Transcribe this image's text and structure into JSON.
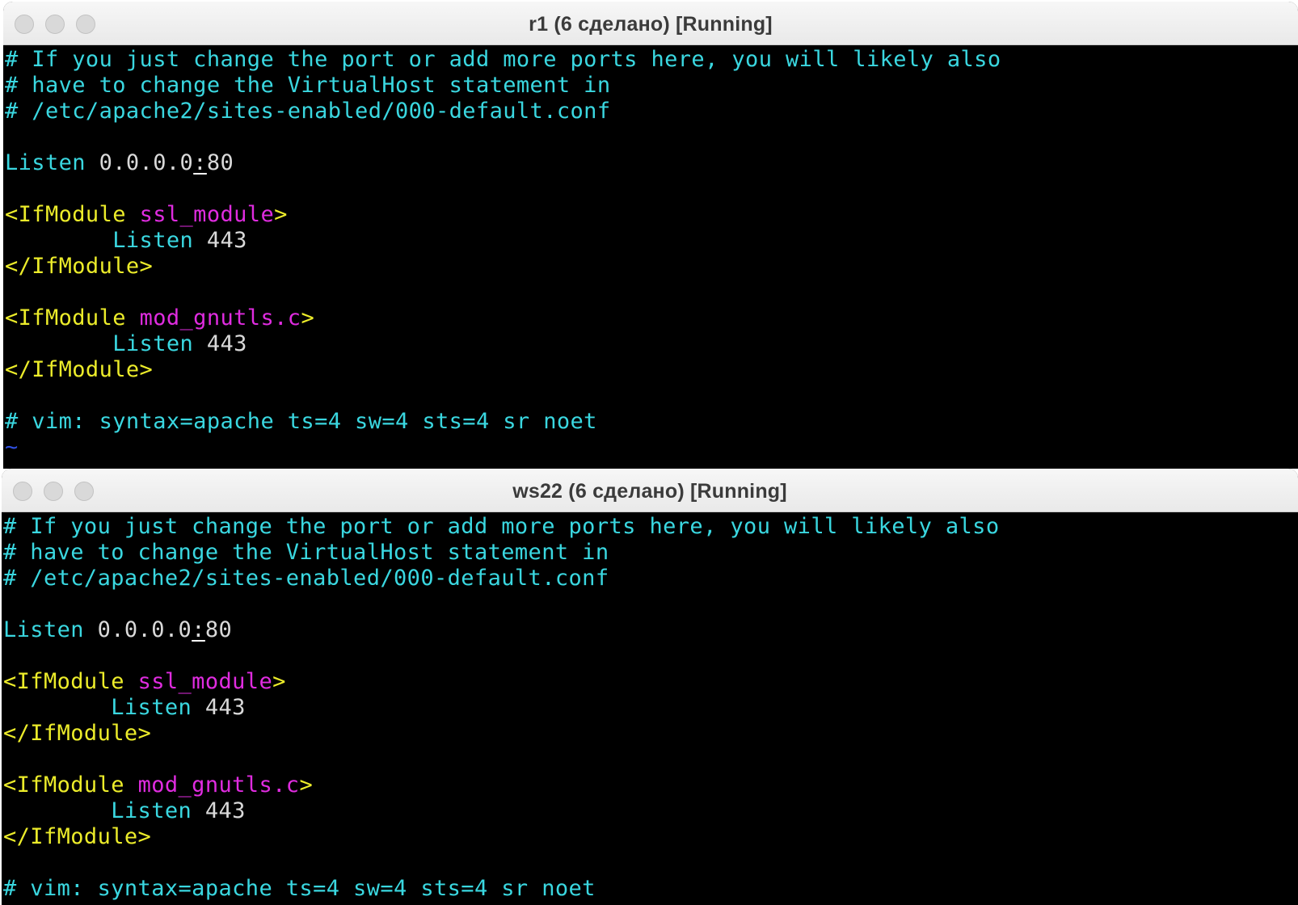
{
  "colors": {
    "comment": "#3ad7e0",
    "directive": "#3ad7e0",
    "tag": "#ecec2a",
    "module": "#e02ce0",
    "value": "#d9d9d9",
    "tilde": "#2f4fe0",
    "background": "#000000",
    "titlebar": "#ececec"
  },
  "windows": [
    {
      "title": "r1 (6 сделано) [Running]",
      "lines": [
        {
          "segments": [
            {
              "text": "# If you just change the port or add more ports here, you will likely also",
              "role": "comment"
            }
          ]
        },
        {
          "segments": [
            {
              "text": "# have to change the VirtualHost statement in",
              "role": "comment"
            }
          ]
        },
        {
          "segments": [
            {
              "text": "# /etc/apache2/sites-enabled/000-default.conf",
              "role": "comment"
            }
          ]
        },
        {
          "segments": []
        },
        {
          "segments": [
            {
              "text": "Listen",
              "role": "directive"
            },
            {
              "text": " 0.0.0.0",
              "role": "value"
            },
            {
              "text": ":",
              "role": "cursor"
            },
            {
              "text": "80",
              "role": "value"
            }
          ]
        },
        {
          "segments": []
        },
        {
          "segments": [
            {
              "text": "<IfModule ",
              "role": "tag"
            },
            {
              "text": "ssl_module",
              "role": "module"
            },
            {
              "text": ">",
              "role": "tag"
            }
          ]
        },
        {
          "segments": [
            {
              "text": "        Listen",
              "role": "directive"
            },
            {
              "text": " 443",
              "role": "value"
            }
          ]
        },
        {
          "segments": [
            {
              "text": "</IfModule>",
              "role": "tag"
            }
          ]
        },
        {
          "segments": []
        },
        {
          "segments": [
            {
              "text": "<IfModule ",
              "role": "tag"
            },
            {
              "text": "mod_gnutls.c",
              "role": "module"
            },
            {
              "text": ">",
              "role": "tag"
            }
          ]
        },
        {
          "segments": [
            {
              "text": "        Listen",
              "role": "directive"
            },
            {
              "text": " 443",
              "role": "value"
            }
          ]
        },
        {
          "segments": [
            {
              "text": "</IfModule>",
              "role": "tag"
            }
          ]
        },
        {
          "segments": []
        },
        {
          "segments": [
            {
              "text": "# vim: syntax=apache ts=4 sw=4 sts=4 sr noet",
              "role": "comment"
            }
          ]
        },
        {
          "segments": [
            {
              "text": "~",
              "role": "tilde"
            }
          ]
        },
        {
          "segments": [
            {
              "text": "~",
              "role": "tilde"
            }
          ]
        }
      ]
    },
    {
      "title": "ws22 (6 сделано) [Running]",
      "lines": [
        {
          "segments": [
            {
              "text": "# If you just change the port or add more ports here, you will likely also",
              "role": "comment"
            }
          ]
        },
        {
          "segments": [
            {
              "text": "# have to change the VirtualHost statement in",
              "role": "comment"
            }
          ]
        },
        {
          "segments": [
            {
              "text": "# /etc/apache2/sites-enabled/000-default.conf",
              "role": "comment"
            }
          ]
        },
        {
          "segments": []
        },
        {
          "segments": [
            {
              "text": "Listen",
              "role": "directive"
            },
            {
              "text": " 0.0.0.0",
              "role": "value"
            },
            {
              "text": ":",
              "role": "cursor"
            },
            {
              "text": "80",
              "role": "value"
            }
          ]
        },
        {
          "segments": []
        },
        {
          "segments": [
            {
              "text": "<IfModule ",
              "role": "tag"
            },
            {
              "text": "ssl_module",
              "role": "module"
            },
            {
              "text": ">",
              "role": "tag"
            }
          ]
        },
        {
          "segments": [
            {
              "text": "        Listen",
              "role": "directive"
            },
            {
              "text": " 443",
              "role": "value"
            }
          ]
        },
        {
          "segments": [
            {
              "text": "</IfModule>",
              "role": "tag"
            }
          ]
        },
        {
          "segments": []
        },
        {
          "segments": [
            {
              "text": "<IfModule ",
              "role": "tag"
            },
            {
              "text": "mod_gnutls.c",
              "role": "module"
            },
            {
              "text": ">",
              "role": "tag"
            }
          ]
        },
        {
          "segments": [
            {
              "text": "        Listen",
              "role": "directive"
            },
            {
              "text": " 443",
              "role": "value"
            }
          ]
        },
        {
          "segments": [
            {
              "text": "</IfModule>",
              "role": "tag"
            }
          ]
        },
        {
          "segments": []
        },
        {
          "segments": [
            {
              "text": "# vim: syntax=apache ts=4 sw=4 sts=4 sr noet",
              "role": "comment"
            }
          ]
        }
      ]
    }
  ]
}
